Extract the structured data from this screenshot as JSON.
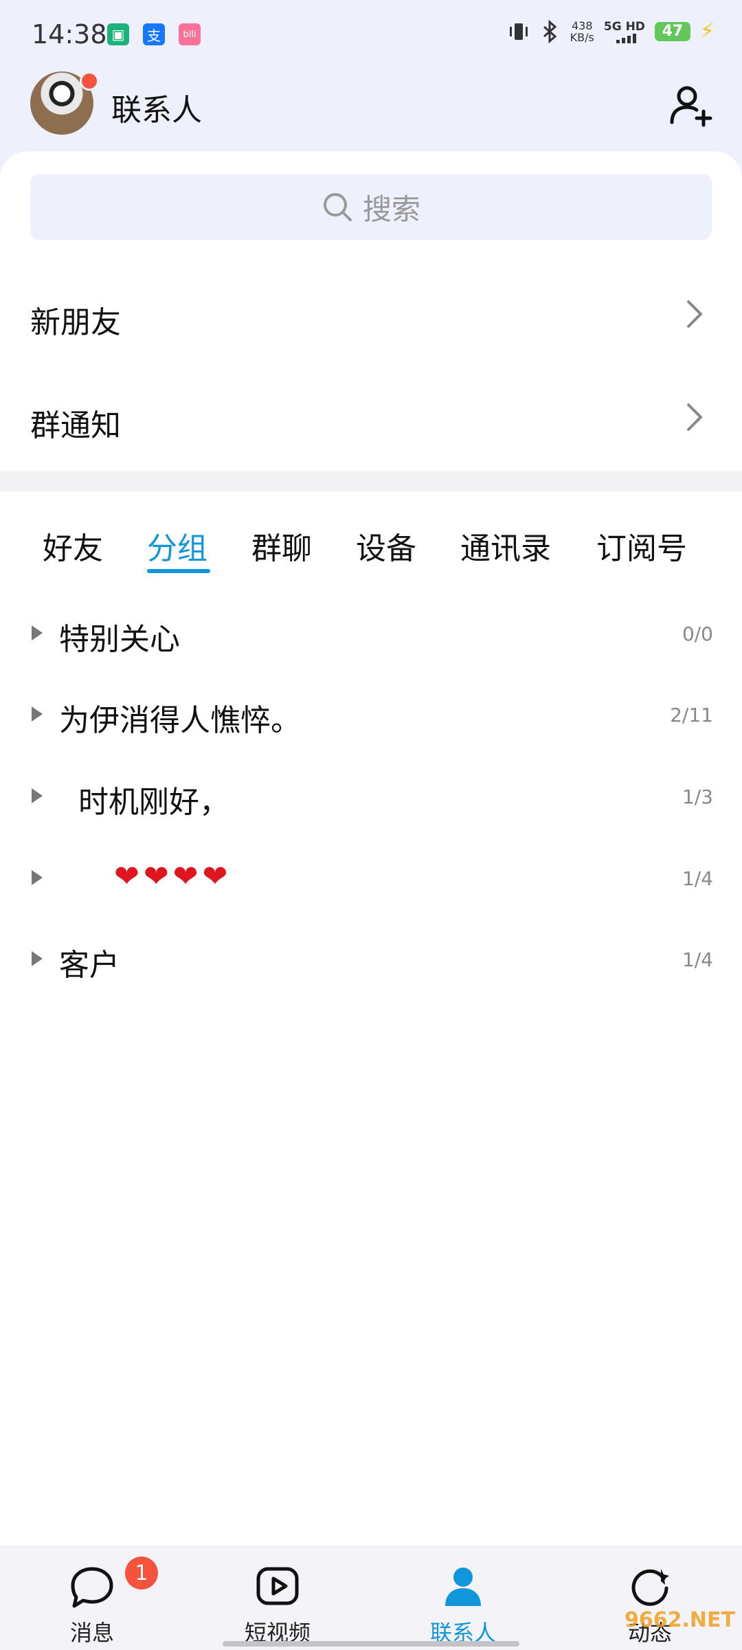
{
  "status_bar": {
    "time": "14:38",
    "app_icons": [
      {
        "label": "",
        "color": "#1db27a"
      },
      {
        "label": "支",
        "color": "#1677ff"
      },
      {
        "label": "bili",
        "color": "#fb7299"
      }
    ],
    "net_speed_value": "438",
    "net_speed_unit": "KB/s",
    "signal_label": "5G HD",
    "battery": "47"
  },
  "header": {
    "title": "联系人"
  },
  "search": {
    "placeholder": "搜索"
  },
  "menu_items": [
    {
      "label": "新朋友"
    },
    {
      "label": "群通知"
    }
  ],
  "tabs": [
    {
      "label": "好友",
      "active": false
    },
    {
      "label": "分组",
      "active": true
    },
    {
      "label": "群聊",
      "active": false
    },
    {
      "label": "设备",
      "active": false
    },
    {
      "label": "通讯录",
      "active": false
    },
    {
      "label": "订阅号",
      "active": false
    }
  ],
  "groups": [
    {
      "name": "特别关心",
      "count": "0/0"
    },
    {
      "name": "为伊消得人憔悴。",
      "count": "2/11"
    },
    {
      "name": "  时机刚好，",
      "count": "1/3"
    },
    {
      "name": "    ❤❤❤❤",
      "count": "1/4"
    },
    {
      "name": "客户",
      "count": "1/4"
    }
  ],
  "bottom_nav": [
    {
      "label": "消息",
      "badge": "1",
      "icon": "chat-bubble-icon"
    },
    {
      "label": "短视频",
      "icon": "video-play-icon"
    },
    {
      "label": "联系人",
      "active": true,
      "icon": "contacts-person-icon"
    },
    {
      "label": "动态",
      "icon": "star-refresh-icon"
    }
  ],
  "watermark": "9662.NET",
  "colors": {
    "accent": "#1296db",
    "badge": "#f5533d",
    "header_bg": "#eef1fb"
  }
}
